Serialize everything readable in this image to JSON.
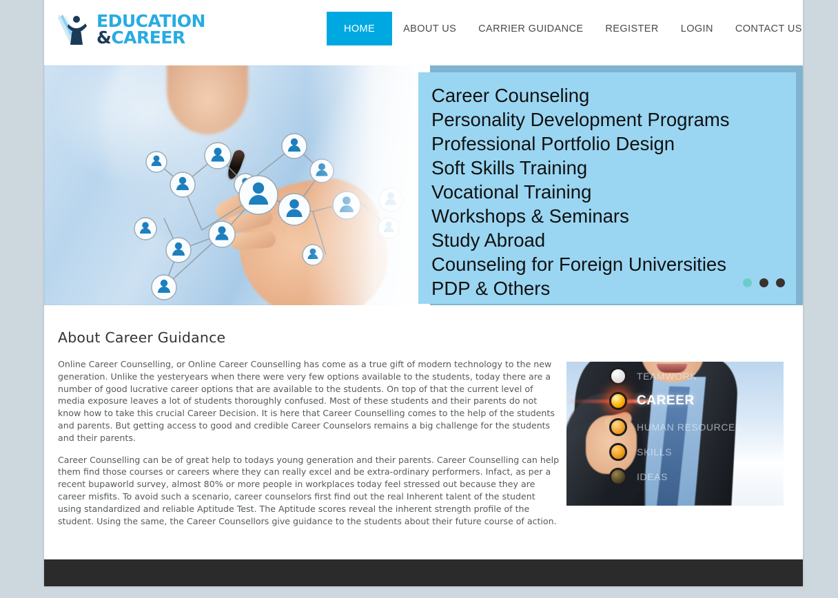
{
  "site": {
    "logo": {
      "line1": "EDUCATION",
      "amp": "&",
      "line2": "CAREER",
      "mark": "graduate-figure-icon"
    },
    "colors": {
      "accent": "#00a8e1",
      "logo_blue": "#29abe2",
      "logo_navy": "#1b3a57",
      "panel_blue": "#9ad6f2",
      "page_bg": "#ccd7de",
      "footer": "#2b2b2b",
      "dot_active": "#6ccdc8",
      "dot_inactive": "#3a322e"
    }
  },
  "nav": {
    "items": [
      {
        "label": "HOME",
        "active": true
      },
      {
        "label": "ABOUT US",
        "active": false
      },
      {
        "label": "CARRIER GUIDANCE",
        "active": false
      },
      {
        "label": "REGISTER",
        "active": false
      },
      {
        "label": "LOGIN",
        "active": false
      },
      {
        "label": "CONTACT US",
        "active": false
      }
    ]
  },
  "hero": {
    "image_alt": "hand-drawing-social-network-diagram",
    "services": [
      "Career Counseling",
      "Personality Development Programs",
      "Professional Portfolio Design",
      "Soft Skills Training",
      "Vocational Training",
      "Workshops & Seminars",
      "Study Abroad",
      "Counseling for Foreign Universities",
      "PDP & Others"
    ],
    "carousel": {
      "slide_count": 3,
      "active_index": 0
    }
  },
  "about": {
    "title": "About Career Guidance",
    "paragraphs": [
      "Online Career Counselling, or Online Career Counselling has come as a true gift of modern technology to the new generation. Unlike the yesteryears when there were very few options available to the students, today there are a number of good lucrative career options that are available to the students. On top of that the current level of media exposure leaves a lot of students thoroughly confused. Most of these students and their parents do not know how to take this crucial Career Decision. It is here that Career Counselling comes to the help of the students and parents. But getting access to good and credible Career Counselors remains a big challenge for the students and their parents.",
      "Career Counselling can be of great help to todays young generation and their parents. Career Counselling can help them find those courses or careers where they can really excel and be extra-ordinary performers. Infact, as per a recent bupaworld survey, almost 80% or more people in workplaces today feel stressed out because they are career misfits. To avoid such a scenario, career counselors first find out the real Inherent talent of the student using standardized and reliable Aptitude Test. The Aptitude scores reveal the inherent strength profile of the student. Using the same, the Career Counsellors give guidance to the students about their future course of action."
    ],
    "side_image": {
      "alt": "businessman-touching-career-interface",
      "options": [
        {
          "label": "TEAMWORK",
          "state": "off"
        },
        {
          "label": "CAREER",
          "state": "selected"
        },
        {
          "label": "HUMAN RESOURCES",
          "state": "off"
        },
        {
          "label": "SKILLS",
          "state": "off"
        },
        {
          "label": "IDEAS",
          "state": "off"
        }
      ]
    }
  }
}
